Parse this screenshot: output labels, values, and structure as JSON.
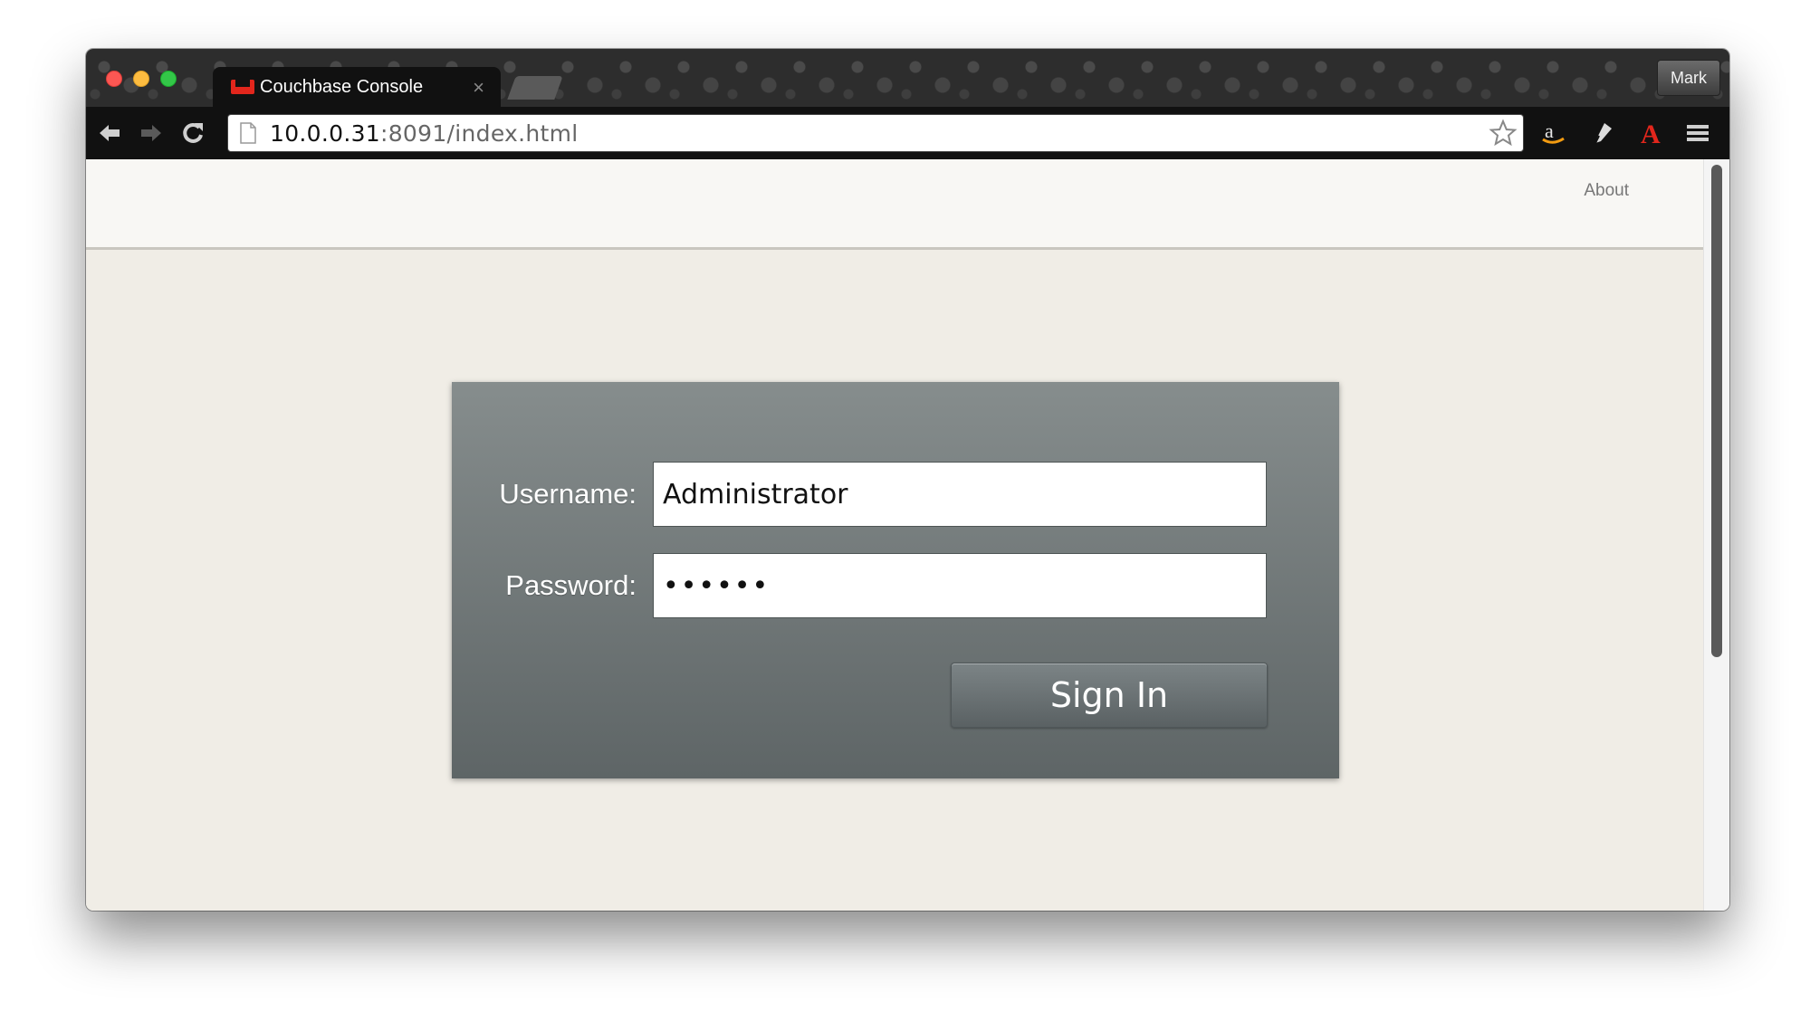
{
  "browser": {
    "tab_title": "Couchbase Console",
    "tab_close": "×",
    "profile_name": "Mark",
    "url_host": "10.0.0.31",
    "url_rest": ":8091/index.html"
  },
  "header": {
    "about_label": "About"
  },
  "login": {
    "username_label": "Username:",
    "username_value": "Administrator",
    "password_label": "Password:",
    "password_value": "••••••",
    "signin_label": "Sign In"
  },
  "colors": {
    "favicon": "#e2261c",
    "panel_top": "#868d8d",
    "panel_bottom": "#5e6566",
    "page_background": "#f0ede6"
  }
}
